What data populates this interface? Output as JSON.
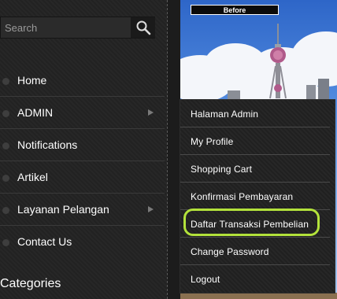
{
  "search": {
    "placeholder": "Search",
    "value": ""
  },
  "sidebar": {
    "items": [
      {
        "label": "Home",
        "has_submenu": false
      },
      {
        "label": "ADMIN",
        "has_submenu": true
      },
      {
        "label": "Notifications",
        "has_submenu": false
      },
      {
        "label": "Artikel",
        "has_submenu": false
      },
      {
        "label": "Layanan Pelangan",
        "has_submenu": true
      },
      {
        "label": "Contact Us",
        "has_submenu": false
      }
    ],
    "categories_heading": "Categories"
  },
  "photo": {
    "caption": "Before"
  },
  "submenu": {
    "items": [
      {
        "label": "Halaman Admin"
      },
      {
        "label": "My Profile"
      },
      {
        "label": "Shopping Cart"
      },
      {
        "label": "Konfirmasi Pembayaran"
      },
      {
        "label": "Daftar Transaksi Pembelian",
        "highlighted": true
      },
      {
        "label": "Change Password"
      },
      {
        "label": "Logout"
      }
    ]
  },
  "colors": {
    "background": "#222222",
    "highlight_ring": "#b3e23b",
    "text": "#ffffff"
  }
}
